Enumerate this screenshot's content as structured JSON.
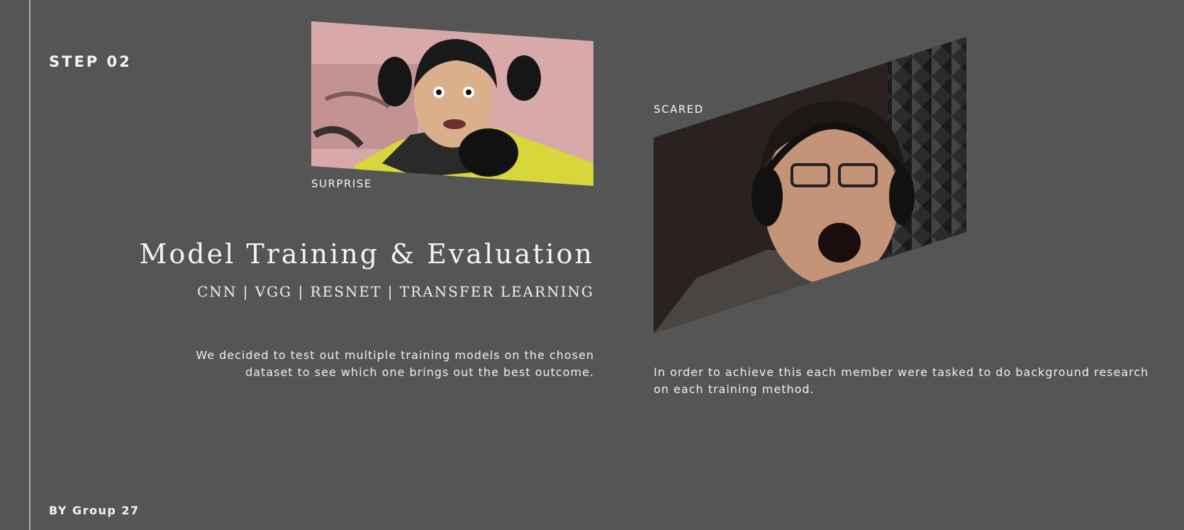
{
  "slide": {
    "step_label": "STEP 02",
    "title": "Model Training & Evaluation",
    "subtitle": "CNN | VGG | RESNET | TRANSFER LEARNING",
    "description_left": "We decided to test out multiple training models on the chosen dataset to see which one brings out the best outcome.",
    "description_right": "In order to achieve this each member were tasked to do background research on each training method.",
    "footer": "BY Group 27"
  },
  "images": [
    {
      "label": "SURPRISE"
    },
    {
      "label": "SCARED"
    }
  ],
  "colors": {
    "background": "#555555",
    "text": "#f4f4f4",
    "vertical_line": "#a9a9a9"
  }
}
